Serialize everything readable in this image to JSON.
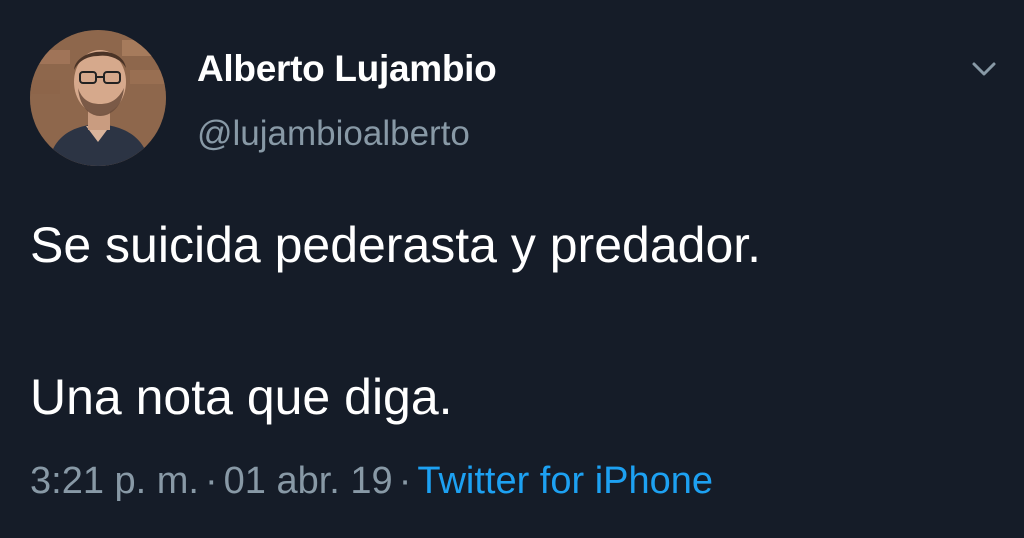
{
  "user": {
    "display_name": "Alberto Lujambio",
    "handle": "@lujambioalberto"
  },
  "tweet": {
    "lines": [
      "Se suicida pederasta y predador.",
      "Una nota que diga."
    ],
    "time": "3:21 p. m.",
    "separator": "·",
    "date": "01 abr. 19",
    "source": "Twitter for iPhone"
  },
  "icons": {
    "menu": "chevron-down-icon"
  },
  "colors": {
    "background": "#151c28",
    "primary_text": "#ffffff",
    "secondary_text": "#8899a6",
    "link": "#1da1f2"
  }
}
